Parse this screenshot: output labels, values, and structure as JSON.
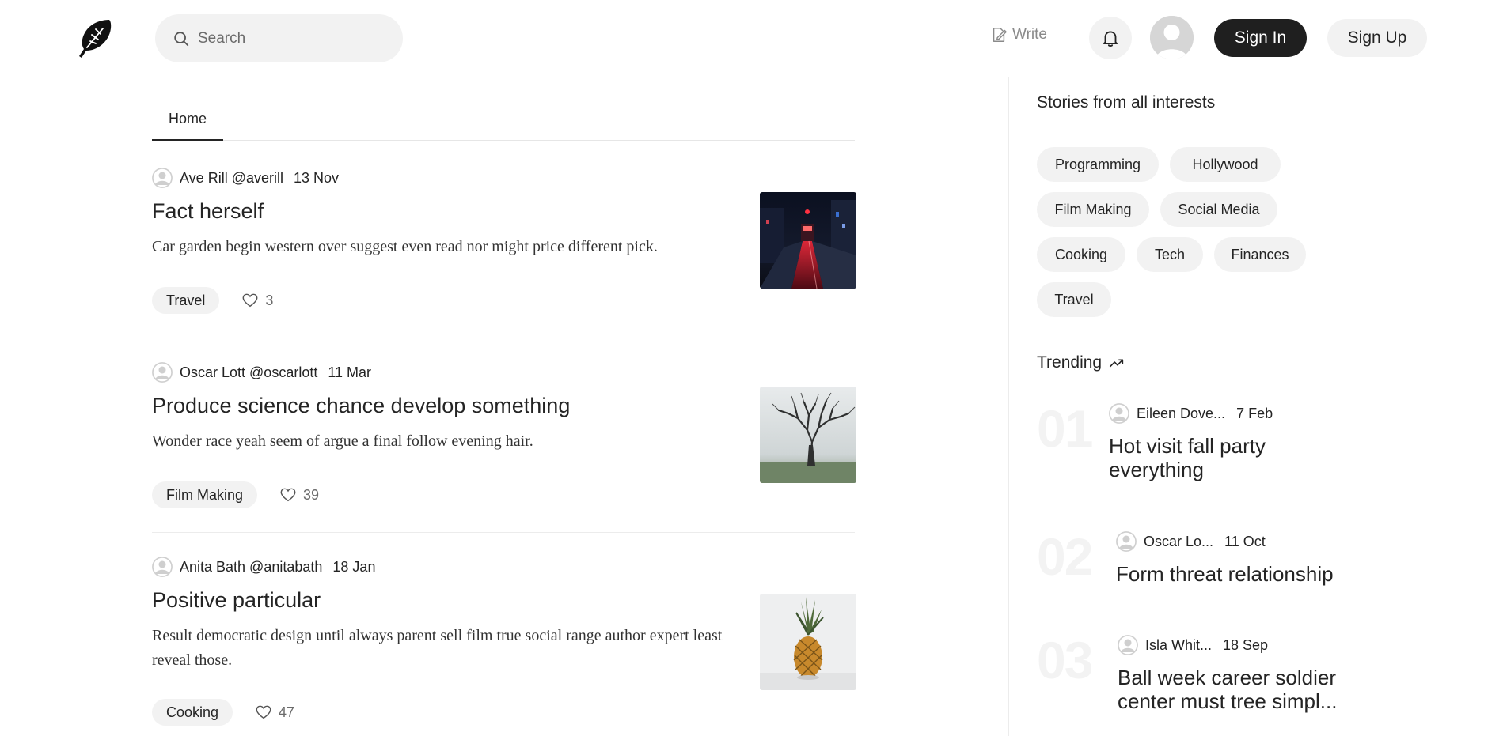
{
  "header": {
    "search_placeholder": "Search",
    "write_label": "Write",
    "sign_in_label": "Sign In",
    "sign_up_label": "Sign Up"
  },
  "tabs": [
    {
      "label": "Home"
    }
  ],
  "articles": [
    {
      "author": "Ave Rill @averill",
      "date": "13 Nov",
      "title": "Fact herself",
      "description": "Car garden begin western over suggest even read nor might price different pick.",
      "tag": "Travel",
      "likes": "3",
      "image": "night-street-tram"
    },
    {
      "author": "Oscar Lott @oscarlott",
      "date": "11 Mar",
      "title": "Produce science chance develop something",
      "description": "Wonder race yeah seem of argue a final follow evening hair.",
      "tag": "Film Making",
      "likes": "39",
      "image": "bare-tree-fog"
    },
    {
      "author": "Anita Bath @anitabath",
      "date": "18 Jan",
      "title": "Positive particular",
      "description": "Result democratic design until always parent sell film true social range author expert least reveal those.",
      "tag": "Cooking",
      "likes": "47",
      "image": "pineapple"
    }
  ],
  "sidebar": {
    "interests_heading": "Stories from all interests",
    "interests": [
      "Programming",
      "Hollywood",
      "Film Making",
      "Social Media",
      "Cooking",
      "Tech",
      "Finances",
      "Travel"
    ],
    "trending_heading": "Trending",
    "trending": [
      {
        "rank": "01",
        "author": "Eileen Dove...",
        "date": "7 Feb",
        "title": "Hot visit fall party everything"
      },
      {
        "rank": "02",
        "author": "Oscar Lo...",
        "date": "11 Oct",
        "title": "Form threat relationship"
      },
      {
        "rank": "03",
        "author": "Isla Whit...",
        "date": "18 Sep",
        "title": "Ball week career soldier center must tree simpl..."
      }
    ]
  },
  "colors": {
    "accent_dark": "#1f1f1f",
    "chip_bg": "#f2f2f2",
    "rank_number": "#f3f3f3"
  }
}
